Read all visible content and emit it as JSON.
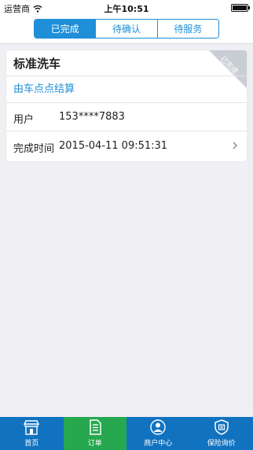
{
  "status_bar": {
    "carrier": "运营商",
    "time": "上午10:51"
  },
  "header": {
    "segments": [
      {
        "label": "已完成",
        "active": true
      },
      {
        "label": "待确认",
        "active": false
      },
      {
        "label": "待服务",
        "active": false
      }
    ]
  },
  "order": {
    "title": "标准洗车",
    "status_ribbon": "已完成",
    "link_text": "由车点点结算",
    "user_label": "用户",
    "user_value": "153****7883",
    "time_label": "完成时间",
    "time_value": "2015-04-11 09:51:31"
  },
  "tab_bar": {
    "items": [
      {
        "label": "首页",
        "icon": "storefront-icon",
        "active": false
      },
      {
        "label": "订单",
        "icon": "document-icon",
        "active": true
      },
      {
        "label": "商户中心",
        "icon": "user-icon",
        "active": false
      },
      {
        "label": "保险询价",
        "icon": "shield-icon",
        "active": false
      }
    ]
  },
  "colors": {
    "accent": "#1e8fd8",
    "tab_bar": "#1173c0",
    "tab_active": "#27a84f",
    "background": "#efeff4"
  }
}
